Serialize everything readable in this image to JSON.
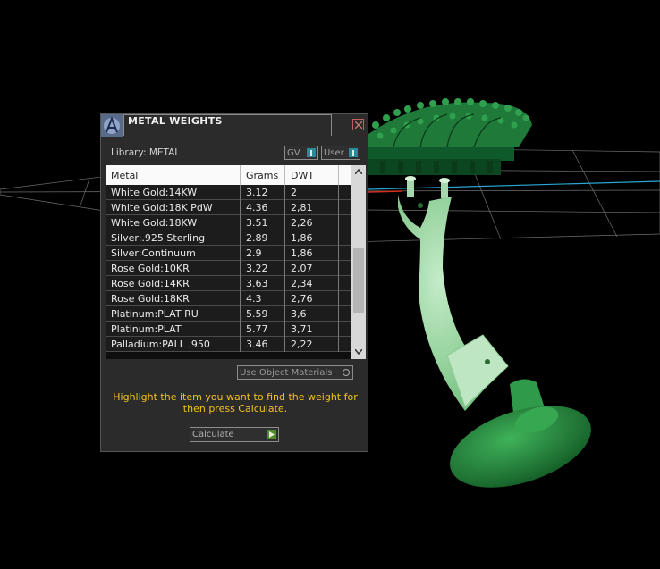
{
  "window": {
    "title": "METAL WEIGHTS"
  },
  "library_label": "Library: METAL",
  "selectors": {
    "gv_label": "GV",
    "user_label": "User"
  },
  "table": {
    "headers": [
      "Metal",
      "Grams",
      "DWT"
    ],
    "rows": [
      {
        "metal": "White Gold:14KW",
        "grams": "3.12",
        "dwt": "2"
      },
      {
        "metal": "White Gold:18K PdW",
        "grams": "4.36",
        "dwt": "2,81"
      },
      {
        "metal": "White Gold:18KW",
        "grams": "3.51",
        "dwt": "2,26"
      },
      {
        "metal": "Silver:.925 Sterling",
        "grams": "2.89",
        "dwt": "1,86"
      },
      {
        "metal": "Silver:Continuum",
        "grams": "2.9",
        "dwt": "1,86"
      },
      {
        "metal": "Rose Gold:10KR",
        "grams": "3.22",
        "dwt": "2,07"
      },
      {
        "metal": "Rose Gold:14KR",
        "grams": "3.63",
        "dwt": "2,34"
      },
      {
        "metal": "Rose Gold:18KR",
        "grams": "4.3",
        "dwt": "2,76"
      },
      {
        "metal": "Platinum:PLAT RU",
        "grams": "5.59",
        "dwt": "3,6"
      },
      {
        "metal": "Platinum:PLAT",
        "grams": "5.77",
        "dwt": "3,71"
      },
      {
        "metal": "Palladium:PALL .950",
        "grams": "3.46",
        "dwt": "2,22"
      }
    ]
  },
  "use_object_label": "Use Object Materials",
  "hint_text": "Highlight the item you want to find the weight for then press Calculate.",
  "calculate_label": "Calculate",
  "colors": {
    "accent": "#f4c21c",
    "model_green": "#2e9a4a",
    "model_light": "#a8dcb0"
  }
}
